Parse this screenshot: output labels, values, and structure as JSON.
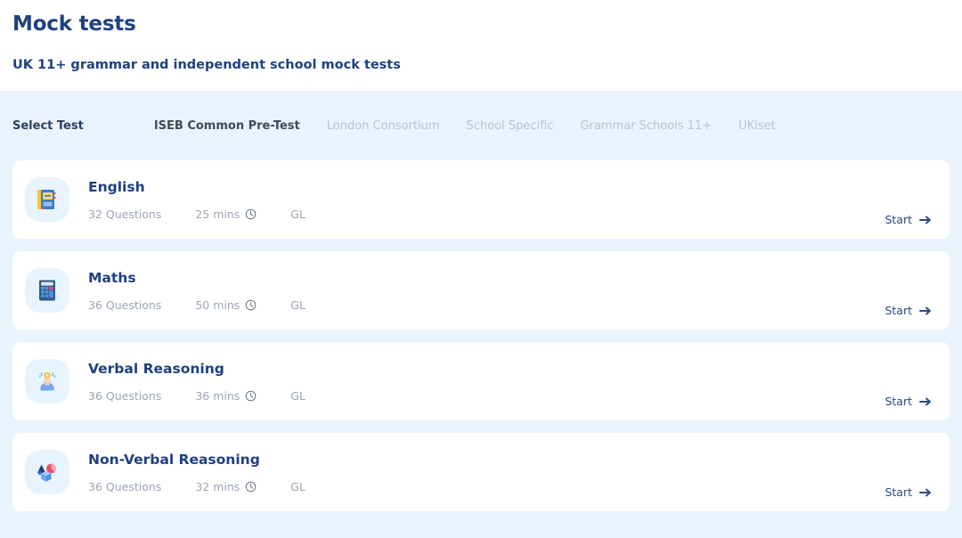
{
  "header": {
    "title": "Mock tests",
    "subtitle": "UK 11+ grammar and independent school mock tests"
  },
  "tabbar": {
    "label": "Select Test",
    "tabs": [
      {
        "label": "ISEB Common Pre-Test",
        "active": true
      },
      {
        "label": "London Consortium",
        "active": false
      },
      {
        "label": "School Specific",
        "active": false
      },
      {
        "label": "Grammar Schools 11+",
        "active": false
      },
      {
        "label": "UKiset",
        "active": false
      }
    ]
  },
  "tests": [
    {
      "title": "English",
      "questions": "32 Questions",
      "time": "25 mins",
      "board": "GL",
      "icon": "book-icon",
      "start_label": "Start"
    },
    {
      "title": "Maths",
      "questions": "36 Questions",
      "time": "50 mins",
      "board": "GL",
      "icon": "calculator-icon",
      "start_label": "Start"
    },
    {
      "title": "Verbal Reasoning",
      "questions": "36 Questions",
      "time": "36 mins",
      "board": "GL",
      "icon": "person-thinking-icon",
      "start_label": "Start"
    },
    {
      "title": "Non-Verbal Reasoning",
      "questions": "36 Questions",
      "time": "32 mins",
      "board": "GL",
      "icon": "shapes-icon",
      "start_label": "Start"
    }
  ],
  "colors": {
    "page_background": "#eaf2fd",
    "card_background": "#ffffff",
    "title_navy": "#1f4080",
    "muted_gray": "#9aa5b5",
    "tab_inactive": "#b9c4d4",
    "tab_active": "#3e4a5a",
    "icon_tile": "#e8f4fd",
    "accent_yellow": "#f5c542",
    "accent_red": "#ef4b6b"
  }
}
